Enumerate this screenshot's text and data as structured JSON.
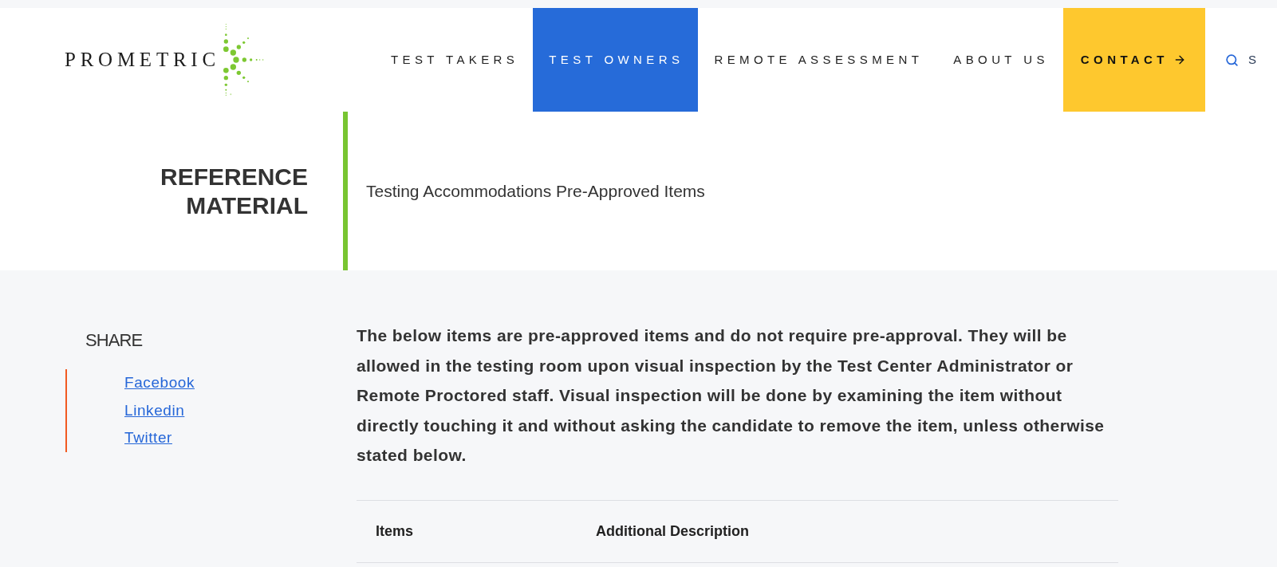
{
  "logo": {
    "wordmark": "PROMETRIC"
  },
  "nav": {
    "items": [
      {
        "label": "TEST TAKERS",
        "kind": "link",
        "selected": false
      },
      {
        "label": "TEST OWNERS",
        "kind": "link",
        "selected": true
      },
      {
        "label": "REMOTE ASSESSMENT",
        "kind": "link",
        "selected": false
      },
      {
        "label": "ABOUT US",
        "kind": "link",
        "selected": false
      },
      {
        "label": "CONTACT",
        "kind": "cta",
        "selected": false
      },
      {
        "label": "S",
        "kind": "search",
        "selected": false
      }
    ]
  },
  "hero": {
    "section_title": "REFERENCE MATERIAL",
    "page_title": "Testing Accommodations Pre-Approved Items"
  },
  "share": {
    "heading": "SHARE",
    "links": [
      "Facebook",
      "Linkedin",
      "Twitter"
    ]
  },
  "content": {
    "intro": "The below items are pre-approved items and do not require pre-approval. They will be allowed in the testing room upon visual inspection by the Test Center Administrator or Remote Proctored staff. Visual inspection will be done by examining the item without directly touching it and without asking the candidate to remove the item, unless otherwise stated below.",
    "table": {
      "columns": [
        "Items",
        "Additional Description"
      ]
    }
  }
}
